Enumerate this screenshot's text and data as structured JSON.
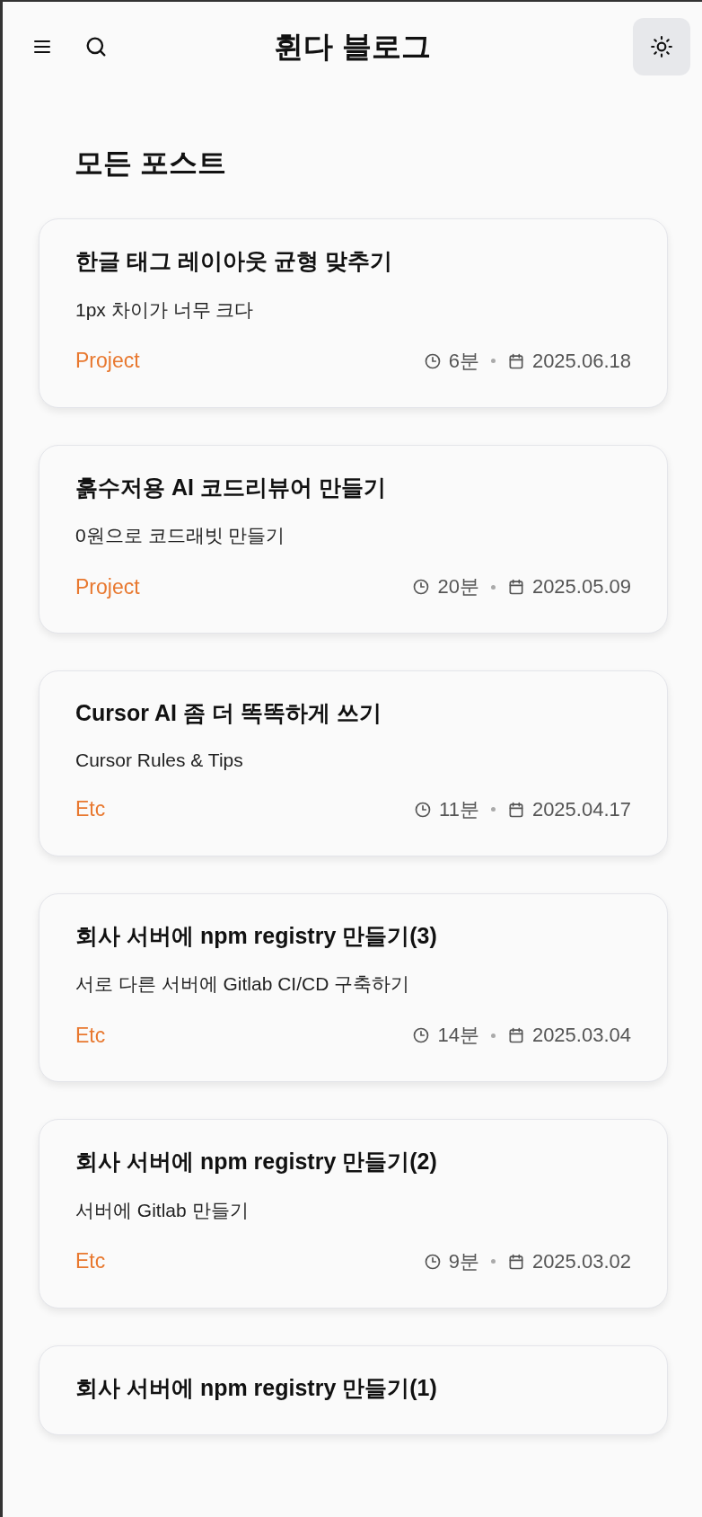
{
  "header": {
    "title": "휜다 블로그"
  },
  "page_title": "모든 포스트",
  "posts": [
    {
      "title": "한글 태그 레이아웃 균형 맞추기",
      "subtitle": "1px 차이가 너무 크다",
      "category": "Project",
      "read_time": "6분",
      "date": "2025.06.18"
    },
    {
      "title": "흙수저용 AI 코드리뷰어 만들기",
      "subtitle": "0원으로 코드래빗 만들기",
      "category": "Project",
      "read_time": "20분",
      "date": "2025.05.09"
    },
    {
      "title": "Cursor AI 좀 더 똑똑하게 쓰기",
      "subtitle": "Cursor Rules & Tips",
      "category": "Etc",
      "read_time": "11분",
      "date": "2025.04.17"
    },
    {
      "title": "회사 서버에 npm registry 만들기(3)",
      "subtitle": "서로 다른 서버에 Gitlab CI/CD 구축하기",
      "category": "Etc",
      "read_time": "14분",
      "date": "2025.03.04"
    },
    {
      "title": "회사 서버에 npm registry 만들기(2)",
      "subtitle": "서버에 Gitlab 만들기",
      "category": "Etc",
      "read_time": "9분",
      "date": "2025.03.02"
    },
    {
      "title": "회사 서버에 npm registry 만들기(1)"
    }
  ]
}
